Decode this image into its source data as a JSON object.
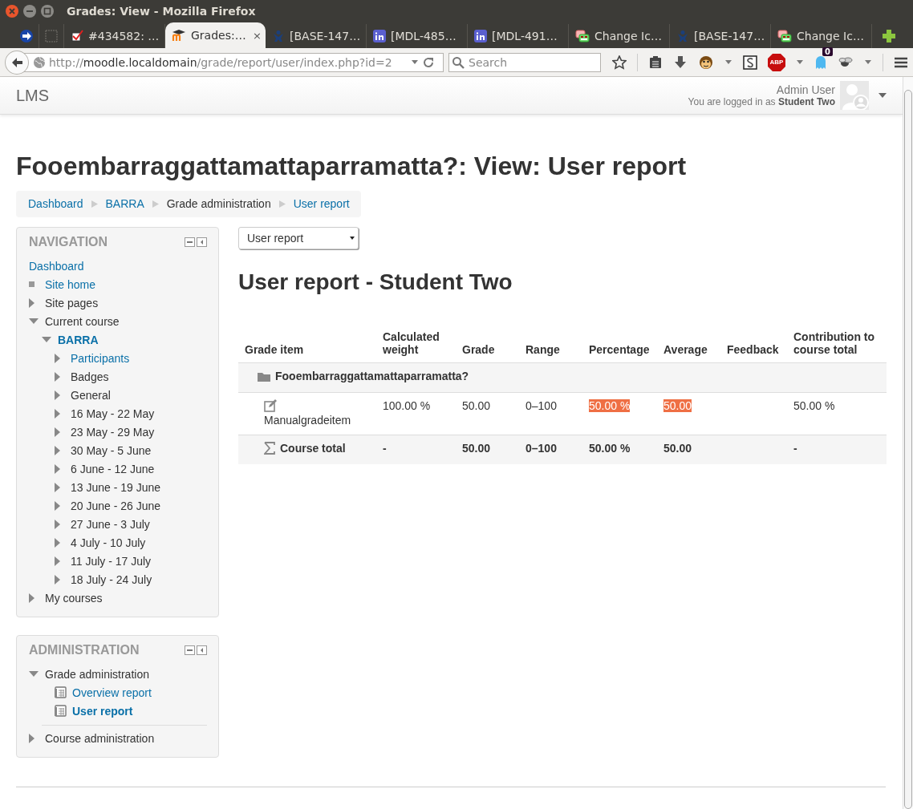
{
  "window": {
    "title": "Grades: View - Mozilla Firefox"
  },
  "tabs": [
    {
      "label": "#434582: …",
      "selected": false,
      "kind": "checkbox"
    },
    {
      "label": "Grades:…",
      "selected": true,
      "kind": "moodle",
      "close": "×"
    },
    {
      "label": "[BASE-147…",
      "selected": false,
      "kind": "jira"
    },
    {
      "label": "[MDL-485…",
      "selected": false,
      "kind": "invision"
    },
    {
      "label": "[MDL-491…",
      "selected": false,
      "kind": "invision"
    },
    {
      "label": "Change Ic…",
      "selected": false,
      "kind": "diff"
    },
    {
      "label": "[BASE-147…",
      "selected": false,
      "kind": "jira"
    },
    {
      "label": "Change Ic…",
      "selected": false,
      "kind": "diff"
    }
  ],
  "toolbar": {
    "url": {
      "scheme": "http://",
      "host": "moodle.localdomain",
      "path": "/grade/report/user/index.php?id=2"
    },
    "search": {
      "placeholder": "Search"
    },
    "adblock_label": "ABP",
    "ghost_badge": "0"
  },
  "header": {
    "brand": "LMS",
    "user_name": "Admin User",
    "login_info": "You are logged in as **Student Two**"
  },
  "page_heading": "Fooembarraggattamattaparramatta?: View: User report",
  "breadcrumbs": [
    {
      "label": "Dashboard",
      "kind": "link"
    },
    {
      "label": "BARRA",
      "kind": "link"
    },
    {
      "label": "Grade administration",
      "kind": "text"
    },
    {
      "label": "User report",
      "kind": "link"
    }
  ],
  "navigation": {
    "title": "NAVIGATION",
    "items": [
      {
        "label": "Dashboard",
        "kind": "root",
        "current": false
      },
      {
        "label": "Site home",
        "kind": "leaf",
        "current": false
      },
      {
        "label": "Site pages",
        "kind": "branch",
        "expanded": false,
        "current": false
      },
      {
        "label": "Current course",
        "kind": "branch",
        "expanded": true,
        "current": false,
        "children": [
          {
            "label": "BARRA",
            "kind": "branch",
            "expanded": true,
            "current": true,
            "children": [
              {
                "label": "Participants",
                "kind": "branch",
                "expanded": false,
                "current": false,
                "link": true
              },
              {
                "label": "Badges",
                "kind": "branch",
                "expanded": false,
                "current": false
              },
              {
                "label": "General",
                "kind": "branch",
                "expanded": false,
                "current": false
              },
              {
                "label": "16 May - 22 May",
                "kind": "branch",
                "expanded": false,
                "current": false
              },
              {
                "label": "23 May - 29 May",
                "kind": "branch",
                "expanded": false,
                "current": false
              },
              {
                "label": "30 May - 5 June",
                "kind": "branch",
                "expanded": false,
                "current": false
              },
              {
                "label": "6 June - 12 June",
                "kind": "branch",
                "expanded": false,
                "current": false
              },
              {
                "label": "13 June - 19 June",
                "kind": "branch",
                "expanded": false,
                "current": false
              },
              {
                "label": "20 June - 26 June",
                "kind": "branch",
                "expanded": false,
                "current": false
              },
              {
                "label": "27 June - 3 July",
                "kind": "branch",
                "expanded": false,
                "current": false
              },
              {
                "label": "4 July - 10 July",
                "kind": "branch",
                "expanded": false,
                "current": false
              },
              {
                "label": "11 July - 17 July",
                "kind": "branch",
                "expanded": false,
                "current": false
              },
              {
                "label": "18 July - 24 July",
                "kind": "branch",
                "expanded": false,
                "current": false
              }
            ]
          }
        ]
      },
      {
        "label": "My courses",
        "kind": "branch",
        "expanded": false,
        "current": false
      }
    ]
  },
  "administration": {
    "title": "ADMINISTRATION",
    "items": [
      {
        "label": "Grade administration",
        "kind": "branch",
        "expanded": true,
        "current": false,
        "children": [
          {
            "label": "Overview report",
            "kind": "report",
            "current": false
          },
          {
            "label": "User report",
            "kind": "report",
            "current": true
          }
        ]
      },
      {
        "label": "Course administration",
        "kind": "branch",
        "expanded": false,
        "current": false,
        "divider": true
      }
    ]
  },
  "report_select": {
    "value": "User report"
  },
  "report_heading": "User report - Student Two",
  "table": {
    "columns": [
      "Grade item",
      "Calculated weight",
      "Grade",
      "Range",
      "Percentage",
      "Average",
      "Feedback",
      "Contribution to course total"
    ],
    "rows": [
      {
        "kind": "category",
        "label": "Fooembarraggattamattaparramatta?"
      },
      {
        "kind": "item",
        "cells": [
          {
            "text": "Manualgradeitem",
            "highlight": false
          },
          {
            "text": "100.00 %",
            "highlight": false
          },
          {
            "text": "50.00",
            "highlight": false
          },
          {
            "text": "0–100",
            "highlight": false
          },
          {
            "text": "50.00 %",
            "highlight": true
          },
          {
            "text": "50.00",
            "highlight": true
          },
          null,
          {
            "text": "50.00 %",
            "highlight": false
          }
        ]
      },
      {
        "kind": "total",
        "cells": [
          {
            "text": "Course total",
            "highlight": false
          },
          {
            "text": "-",
            "highlight": false
          },
          {
            "text": "50.00",
            "highlight": false
          },
          {
            "text": "0–100",
            "highlight": false
          },
          {
            "text": "50.00 %",
            "highlight": false
          },
          {
            "text": "50.00",
            "highlight": false
          },
          null,
          {
            "text": "-",
            "highlight": false
          }
        ]
      }
    ]
  }
}
